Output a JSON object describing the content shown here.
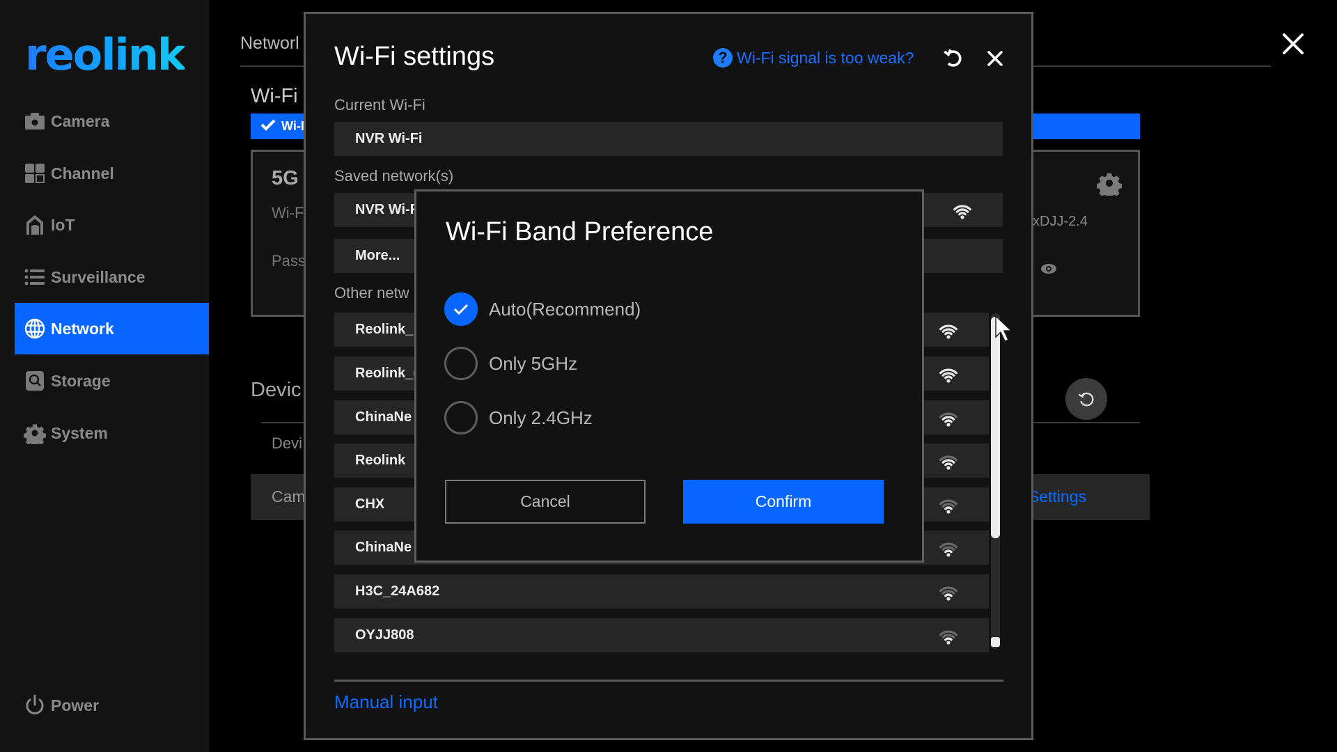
{
  "sidebar": {
    "logo": "reolink",
    "items": [
      {
        "label": "Camera",
        "icon": "camera-icon",
        "active": false
      },
      {
        "label": "Channel",
        "icon": "channel-grid-icon",
        "active": false
      },
      {
        "label": "IoT",
        "icon": "iot-house-icon",
        "active": false
      },
      {
        "label": "Surveillance",
        "icon": "list-icon",
        "active": false
      },
      {
        "label": "Network",
        "icon": "globe-icon",
        "active": true
      },
      {
        "label": "Storage",
        "icon": "storage-icon",
        "active": false
      },
      {
        "label": "System",
        "icon": "gear-icon",
        "active": false
      }
    ],
    "power_label": "Power"
  },
  "background_page": {
    "header_title": "Networl",
    "wifi_title": "Wi-Fi",
    "wifi_toggle_label": "Wi-I",
    "card_band": "5G",
    "card_wifi_label": "Wi-F",
    "card_password_label": "Pass",
    "card_ssid_fragment": "xDJJ-2.4",
    "device_title": "Devic",
    "device_sub": "Devi",
    "camera_row_label": "Cam",
    "camera_row_link": "Settings"
  },
  "wifi_settings": {
    "title": "Wi-Fi settings",
    "help_link": "Wi-Fi signal is too weak?",
    "current_label": "Current Wi-Fi",
    "current_value": "NVR Wi-Fi",
    "saved_label": "Saved network(s)",
    "saved_networks": [
      {
        "name": "NVR Wi-F",
        "signal": 3
      }
    ],
    "more_label": "More...",
    "other_label": "Other netw",
    "other_networks": [
      {
        "name": "Reolink_",
        "signal": 3
      },
      {
        "name": "Reolink_(",
        "signal": 3
      },
      {
        "name": "ChinaNe",
        "signal": 2
      },
      {
        "name": "Reolink",
        "signal": 2
      },
      {
        "name": "CHX",
        "signal": 1
      },
      {
        "name": "ChinaNe",
        "signal": 1
      },
      {
        "name": "H3C_24A682",
        "signal": 1
      },
      {
        "name": "OYJJ808",
        "signal": 1
      }
    ],
    "manual_input": "Manual input"
  },
  "band_dialog": {
    "title": "Wi-Fi Band Preference",
    "options": [
      {
        "label": "Auto(Recommend)",
        "checked": true
      },
      {
        "label": "Only 5GHz",
        "checked": false
      },
      {
        "label": "Only 2.4GHz",
        "checked": false
      }
    ],
    "cancel_label": "Cancel",
    "confirm_label": "Confirm"
  },
  "colors": {
    "accent": "#0766ff",
    "link": "#0a6cff",
    "sidebar_bg": "#131313",
    "modal_bg": "#121212",
    "row_bg": "#262626"
  }
}
